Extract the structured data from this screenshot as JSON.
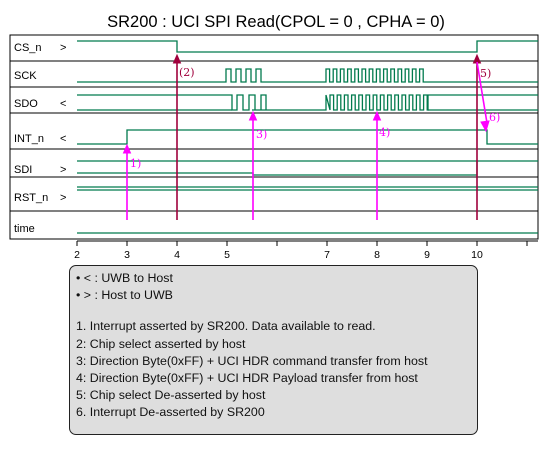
{
  "title": "SR200 : UCI SPI Read(CPOL = 0 , CPHA = 0)",
  "signals": [
    {
      "name": "CS_n",
      "direction": ">"
    },
    {
      "name": "SCK",
      "direction": ""
    },
    {
      "name": "SDO",
      "direction": "<"
    },
    {
      "name": "INT_n",
      "direction": "<"
    },
    {
      "name": "SDI",
      "direction": ">"
    },
    {
      "name": "RST_n",
      "direction": ">"
    },
    {
      "name": "time",
      "direction": ""
    }
  ],
  "time_ticks": [
    "2",
    "3",
    "4",
    "5",
    "7",
    "8",
    "9",
    "10"
  ],
  "events": [
    {
      "label": "1)",
      "time": 3,
      "color": "#ff00ff"
    },
    {
      "label": "(2)",
      "time": 4,
      "color": "#a0003c"
    },
    {
      "label": "3)",
      "time": 5.5,
      "color": "#ff00ff"
    },
    {
      "label": "4)",
      "time": 8,
      "color": "#ff00ff"
    },
    {
      "label": "5)",
      "time": 10,
      "color": "#a0003c"
    },
    {
      "label": "6)",
      "time": 10.2,
      "color": "#ff00ff"
    }
  ],
  "legend": {
    "lines": [
      "• < : UWB to Host",
      "• > : Host to UWB",
      "",
      "1. Interrupt asserted by SR200. Data available to read.",
      "2: Chip select asserted by host",
      "3: Direction Byte(0xFF) + UCI HDR command transfer from host",
      "4: Direction Byte(0xFF) + UCI HDR Payload transfer from host",
      "5: Chip select De-asserted by host",
      "6. Interrupt De-asserted by SR200"
    ]
  },
  "colors": {
    "waveform": "#007a4d",
    "magenta": "#ff00ff",
    "crimson": "#a0003c",
    "grid": "#000000"
  }
}
